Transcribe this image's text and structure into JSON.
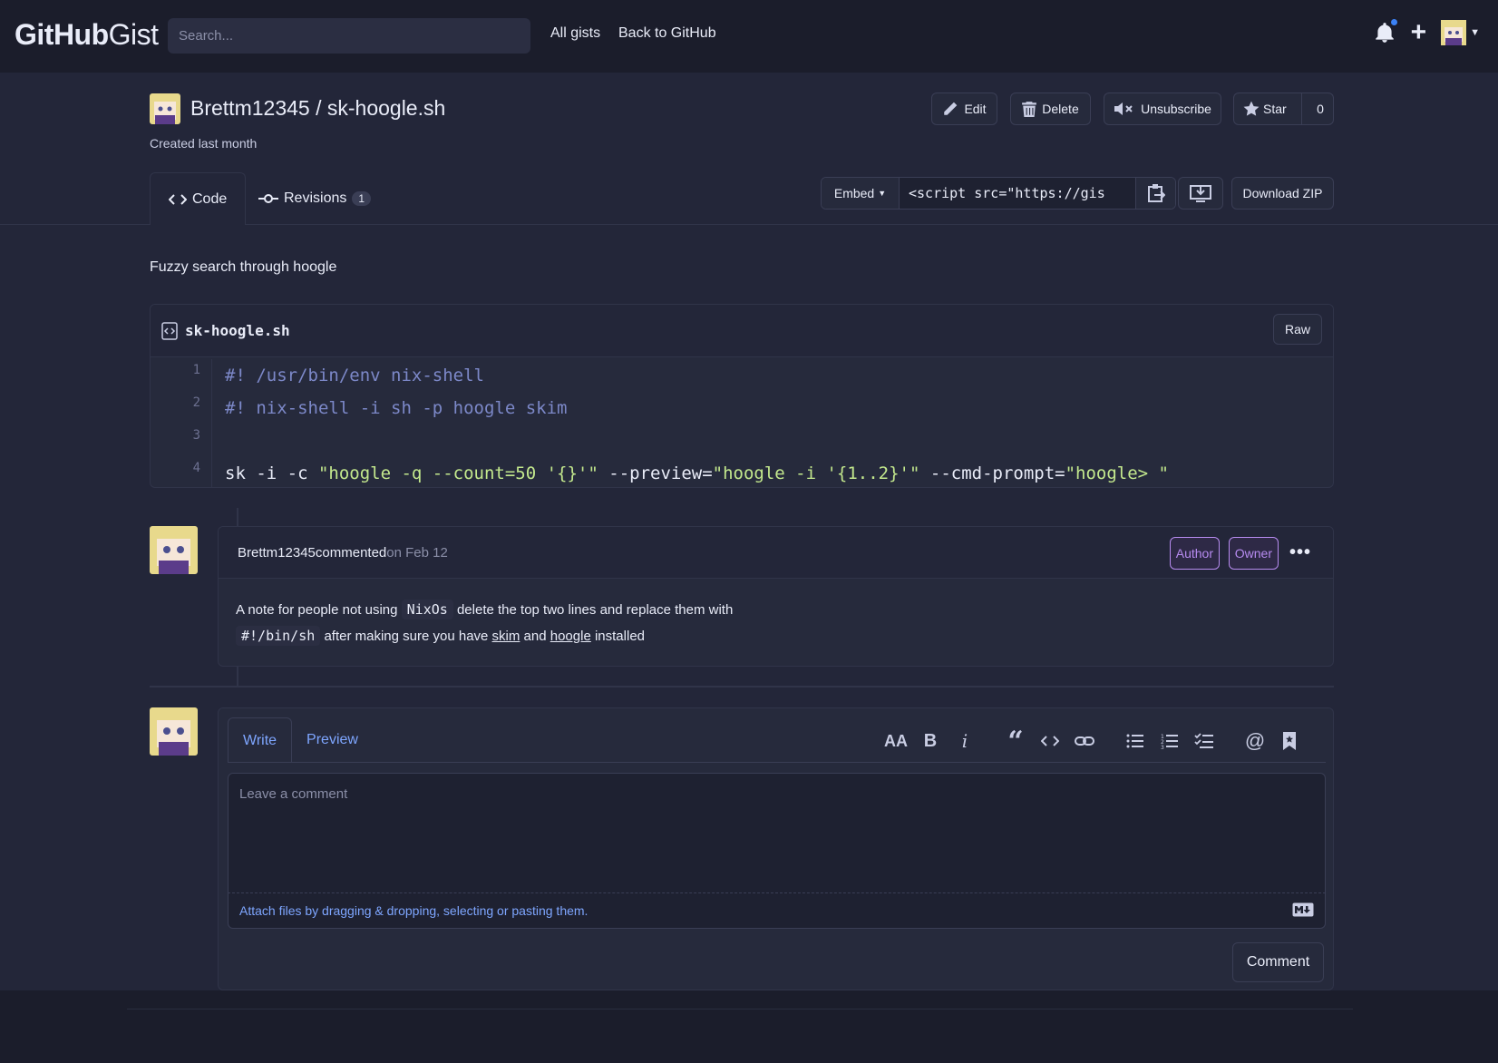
{
  "header": {
    "logo_bold": "GitHub",
    "logo_light": "Gist",
    "search_placeholder": "Search...",
    "nav": [
      "All gists",
      "Back to GitHub"
    ],
    "notification_dot_color": "#3b82f6"
  },
  "gist": {
    "owner": "Brettm12345",
    "separator": " / ",
    "filename": "sk-hoogle.sh",
    "created": "Created last month",
    "description": "Fuzzy search through hoogle",
    "actions": {
      "edit": "Edit",
      "delete": "Delete",
      "unsubscribe": "Unsubscribe",
      "star": "Star",
      "star_count": "0"
    }
  },
  "tabs": {
    "code": "Code",
    "revisions": "Revisions",
    "revisions_count": "1"
  },
  "embed": {
    "label": "Embed",
    "value": "<script src=\"https://gis",
    "download_zip": "Download ZIP"
  },
  "file": {
    "name": "sk-hoogle.sh",
    "raw": "Raw",
    "lines": [
      {
        "num": "1",
        "text": "#! /usr/bin/env nix-shell"
      },
      {
        "num": "2",
        "text": "#! nix-shell -i sh -p hoogle skim"
      },
      {
        "num": "3",
        "text": ""
      },
      {
        "num": "4",
        "text": "sk -i -c \"hoogle -q --count=50 '{}'\" --preview=\"hoogle -i '{1..2}'\" --cmd-prompt=\"hoogle> \""
      }
    ],
    "line4_parts": {
      "a": "sk -i -c ",
      "b": "\"hoogle -q --count=50 '{}'\"",
      "c": " --preview=",
      "d": "\"hoogle -i '{1..2}'\"",
      "e": " --cmd-prompt=",
      "f": "\"hoogle> \""
    }
  },
  "comment": {
    "author": "Brettm12345",
    "action": " commented",
    "date": " on Feb 12",
    "badges": [
      "Author",
      "Owner"
    ],
    "body": {
      "p1": "A note for people not using ",
      "code1": "NixOs",
      "p2": " delete the top two lines and replace them with",
      "code2": "#!/bin/sh",
      "p3": " after making sure you have ",
      "link1": "skim",
      "p4": " and ",
      "link2": "hoogle",
      "p5": " installed"
    }
  },
  "compose": {
    "write_tab": "Write",
    "preview_tab": "Preview",
    "placeholder": "Leave a comment",
    "attach": "Attach files by dragging & dropping, selecting or pasting them.",
    "submit": "Comment",
    "toolbar_icons": [
      "heading-icon",
      "bold-icon",
      "italic-icon",
      "quote-icon",
      "code-icon",
      "link-icon",
      "unordered-list-icon",
      "ordered-list-icon",
      "task-list-icon",
      "mention-icon",
      "saved-reply-icon"
    ]
  },
  "colors": {
    "background": "#232639",
    "header": "#1b1d2b",
    "accent_link": "#7ea6ff",
    "badge": "#b78bf0",
    "string": "#c3e88d",
    "comment_code": "#7c88c8"
  }
}
